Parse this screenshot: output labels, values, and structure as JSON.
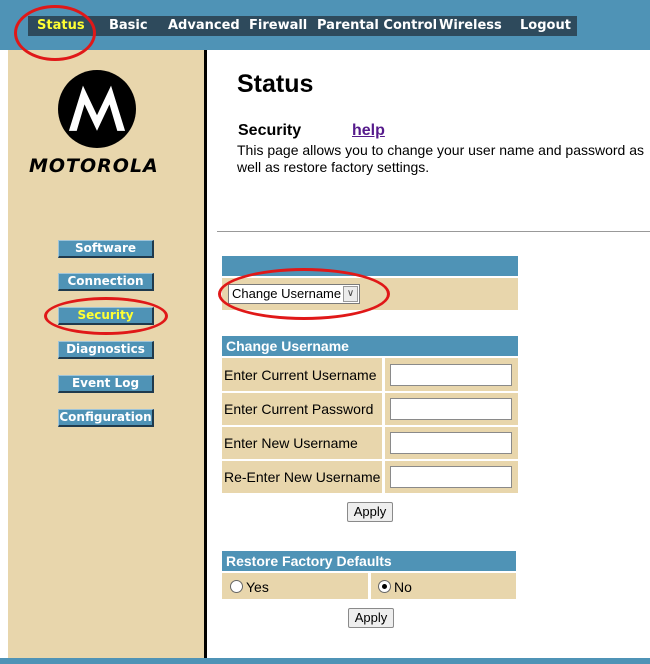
{
  "nav": {
    "items": [
      "Status",
      "Basic",
      "Advanced",
      "Firewall",
      "Parental Control",
      "Wireless",
      "Logout"
    ],
    "active": "Status"
  },
  "brand": {
    "name": "MOTOROLA",
    "logo_icon": "motorola-batwing-icon"
  },
  "sidebar": {
    "items": [
      "Software",
      "Connection",
      "Security",
      "Diagnostics",
      "Event Log",
      "Configuration"
    ],
    "active": "Security"
  },
  "page": {
    "title": "Status",
    "section": "Security",
    "help": "help",
    "description": "This page allows you to change your user name and password as well as restore factory settings."
  },
  "mode_select": {
    "value": "Change Username",
    "arrow_icon": "chevron-down-icon"
  },
  "change_username": {
    "title": "Change Username",
    "fields": [
      "Enter Current Username",
      "Enter Current Password",
      "Enter New Username",
      "Re-Enter New Username"
    ],
    "apply": "Apply"
  },
  "restore": {
    "title": "Restore Factory Defaults",
    "yes": "Yes",
    "no": "No",
    "selected": "No",
    "apply": "Apply"
  },
  "colors": {
    "nav_blue": "#4f93b6",
    "nav_strip": "#2e4a5c",
    "tan": "#e8d6ac",
    "active_text": "#ffff33",
    "annotation_red": "#e01818"
  }
}
